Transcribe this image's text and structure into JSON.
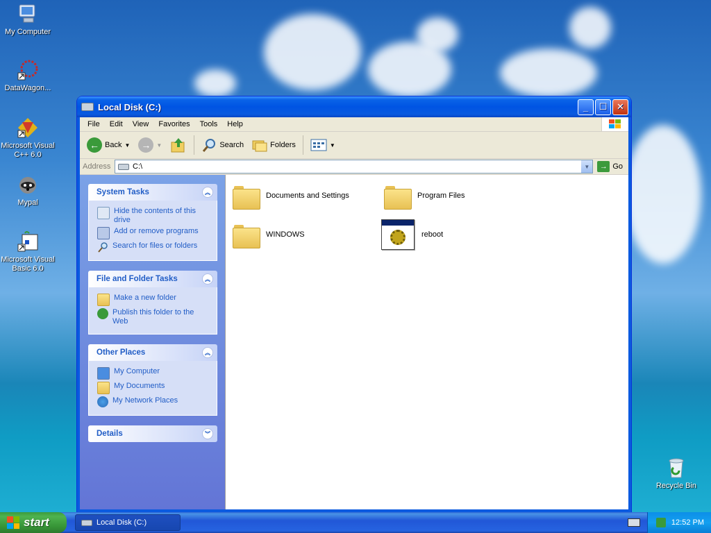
{
  "desktop": {
    "icons": [
      {
        "label": "My Computer"
      },
      {
        "label": "DataWagon..."
      },
      {
        "label": "Microsoft Visual C++ 6.0"
      },
      {
        "label": "Mypal"
      },
      {
        "label": "Microsoft Visual Basic 6.0"
      },
      {
        "label": "Recycle Bin"
      }
    ]
  },
  "window": {
    "title": "Local Disk (C:)",
    "menu": [
      "File",
      "Edit",
      "View",
      "Favorites",
      "Tools",
      "Help"
    ],
    "toolbar": {
      "back": "Back",
      "search": "Search",
      "folders": "Folders"
    },
    "address": {
      "label": "Address",
      "value": "C:\\",
      "go": "Go"
    },
    "panels": [
      {
        "title": "System Tasks",
        "tasks": [
          "Hide the contents of this drive",
          "Add or remove programs",
          "Search for files or folders"
        ]
      },
      {
        "title": "File and Folder Tasks",
        "tasks": [
          "Make a new folder",
          "Publish this folder to the Web"
        ]
      },
      {
        "title": "Other Places",
        "tasks": [
          "My Computer",
          "My Documents",
          "My Network Places"
        ]
      },
      {
        "title": "Details",
        "tasks": []
      }
    ],
    "items": [
      {
        "name": "Documents and Settings",
        "type": "folder"
      },
      {
        "name": "Program Files",
        "type": "folder"
      },
      {
        "name": "WINDOWS",
        "type": "folder"
      },
      {
        "name": "reboot",
        "type": "exe"
      }
    ]
  },
  "taskbar": {
    "start": "start",
    "task": "Local Disk (C:)",
    "clock": "12:52 PM"
  }
}
